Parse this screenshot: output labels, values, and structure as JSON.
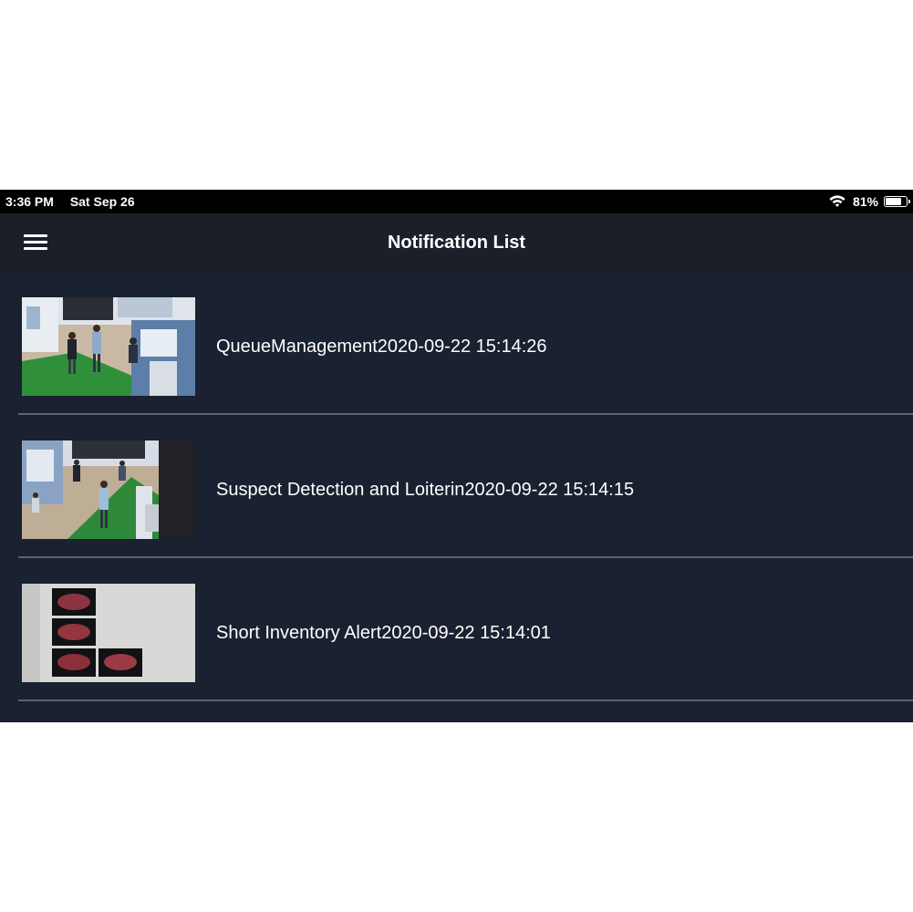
{
  "status_bar": {
    "time": "3:36 PM",
    "date": "Sat Sep 26",
    "battery": "81%",
    "battery_level": 0.81
  },
  "nav": {
    "title": "Notification List",
    "menu_icon": "hamburger-menu-icon"
  },
  "notifications": [
    {
      "label": "QueueManagement2020-09-22 15:14:26",
      "thumbnail": "store-camera-thumbnail"
    },
    {
      "label": "Suspect Detection and Loiterin2020-09-22 15:14:15",
      "thumbnail": "store-camera-thumbnail"
    },
    {
      "label": "Short Inventory Alert2020-09-22 15:14:01",
      "thumbnail": "meat-tray-thumbnail"
    }
  ],
  "colors": {
    "background": "#1a2130",
    "nav_background": "#1c1f27",
    "divider": "#5b6472",
    "text": "#ffffff"
  }
}
